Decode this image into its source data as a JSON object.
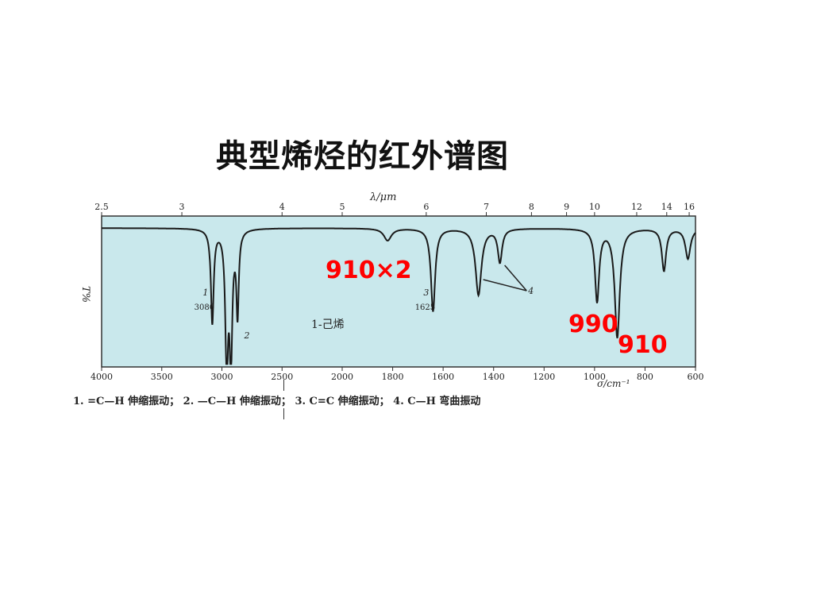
{
  "slide": {
    "title": "典型烯烃的红外谱图",
    "caption": "1. =C—H 伸缩振动； 2. —C—H 伸缩振动； 3. C=C 伸缩振动； 4. C—H 弯曲振动"
  },
  "annotations": {
    "overtone": "910×2",
    "peak_990": "990",
    "peak_910": "910"
  },
  "colors": {
    "plot_bg": "#c9e8ec",
    "trace": "#1a1a1a",
    "annotation": "#ff0000"
  },
  "chart_data": {
    "type": "line",
    "title": "",
    "compound_label": "1-己烯",
    "xlabel": "σ/cm⁻¹",
    "x2label": "λ/μm",
    "ylabel": "T%",
    "xlim": [
      4000,
      600
    ],
    "ylim": [
      0,
      100
    ],
    "x_ticks": [
      4000,
      3500,
      3000,
      2500,
      2000,
      1800,
      1600,
      1400,
      1200,
      1000,
      800,
      600
    ],
    "x_tick_labels": [
      "4000",
      "3500",
      "3000",
      "2500",
      "2000",
      "1800",
      "1600",
      "1400",
      "1200",
      "1000",
      "800",
      "600"
    ],
    "x2_tick_labels": [
      "2.5",
      "3",
      "4",
      "5",
      "6",
      "7",
      "8",
      "9",
      "10",
      "12",
      "14",
      "16"
    ],
    "x2_tick_wavenumbers": [
      4000,
      3333,
      2500,
      2000,
      1667,
      1429,
      1250,
      1111,
      1000,
      833,
      714,
      625
    ],
    "baseline": 92,
    "bands": [
      {
        "center": 3080,
        "depth": 62,
        "width": 14
      },
      {
        "center": 2960,
        "depth": 88,
        "width": 14
      },
      {
        "center": 2925,
        "depth": 84,
        "width": 14
      },
      {
        "center": 2870,
        "depth": 55,
        "width": 12
      },
      {
        "center": 1820,
        "depth": 8,
        "width": 18
      },
      {
        "center": 1640,
        "depth": 55,
        "width": 10
      },
      {
        "center": 1460,
        "depth": 44,
        "width": 14
      },
      {
        "center": 1375,
        "depth": 22,
        "width": 10
      },
      {
        "center": 990,
        "depth": 48,
        "width": 10
      },
      {
        "center": 910,
        "depth": 72,
        "width": 12
      },
      {
        "center": 725,
        "depth": 28,
        "width": 10
      },
      {
        "center": 630,
        "depth": 20,
        "width": 12
      }
    ],
    "peak_labels": [
      {
        "x": 3080,
        "number": "1",
        "value": "3080"
      },
      {
        "x": 2960,
        "number": "2",
        "value": ""
      },
      {
        "x": 1640,
        "number": "3",
        "value": "1625"
      },
      {
        "x": 1200,
        "number": "4",
        "value": ""
      }
    ]
  }
}
